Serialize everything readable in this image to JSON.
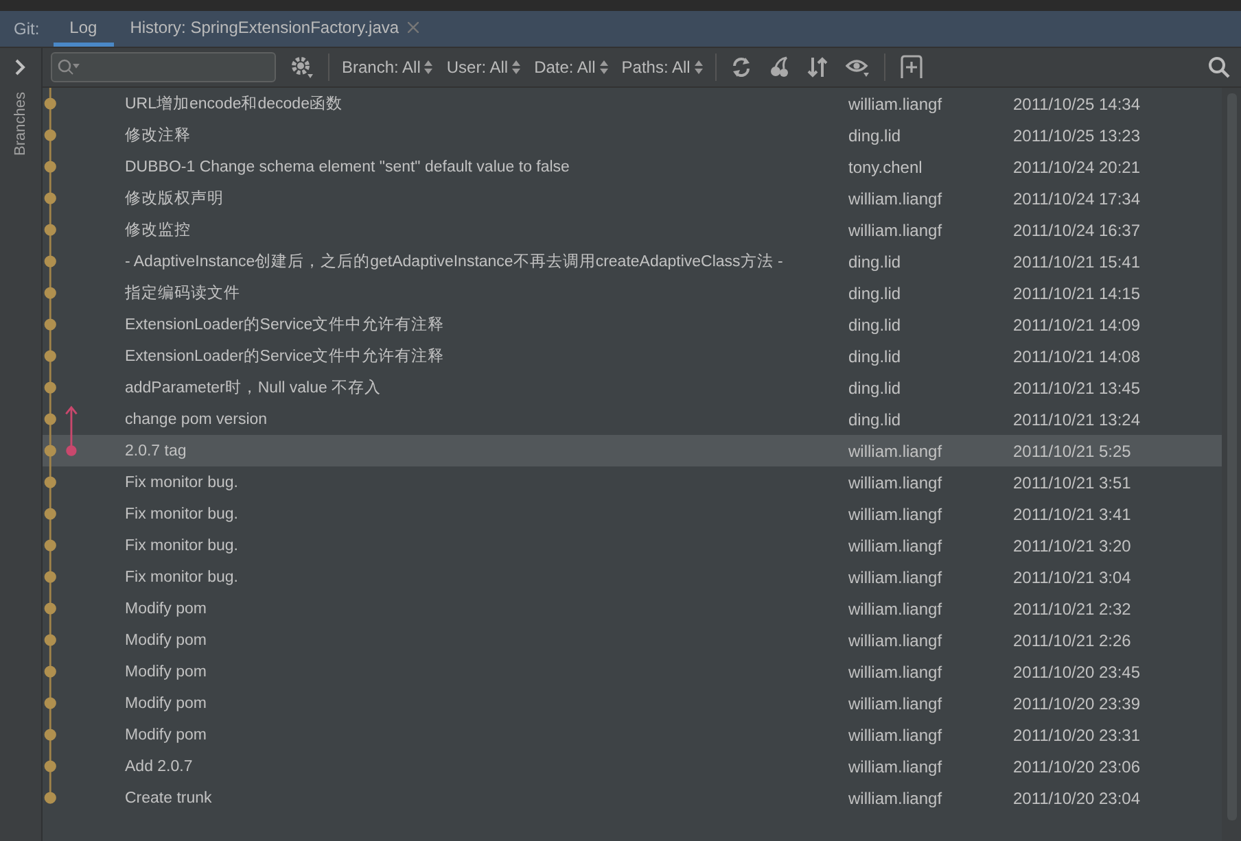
{
  "tabs": {
    "prefix": "Git:",
    "items": [
      {
        "label": "Log",
        "selected": true,
        "closable": false
      },
      {
        "label": "History: SpringExtensionFactory.java",
        "selected": false,
        "closable": true
      }
    ]
  },
  "sidebar": {
    "label": "Branches"
  },
  "toolbar": {
    "filters": [
      "Branch: All",
      "User: All",
      "Date: All",
      "Paths: All"
    ]
  },
  "log": {
    "rows": [
      {
        "message": "URL增加encode和decode函数",
        "author": "william.liangf",
        "date": "2011/10/25 14:34",
        "selected": false
      },
      {
        "message": "修改注释",
        "author": "ding.lid",
        "date": "2011/10/25 13:23",
        "selected": false
      },
      {
        "message": "DUBBO-1 Change schema element \"sent\" default value to false",
        "author": "tony.chenl",
        "date": "2011/10/24 20:21",
        "selected": false
      },
      {
        "message": "修改版权声明",
        "author": "william.liangf",
        "date": "2011/10/24 17:34",
        "selected": false
      },
      {
        "message": "修改监控",
        "author": "william.liangf",
        "date": "2011/10/24 16:37",
        "selected": false
      },
      {
        "message": "- AdaptiveInstance创建后，之后的getAdaptiveInstance不再去调用createAdaptiveClass方法 -",
        "author": "ding.lid",
        "date": "2011/10/21 15:41",
        "selected": false
      },
      {
        "message": "指定编码读文件",
        "author": "ding.lid",
        "date": "2011/10/21 14:15",
        "selected": false
      },
      {
        "message": "ExtensionLoader的Service文件中允许有注释",
        "author": "ding.lid",
        "date": "2011/10/21 14:09",
        "selected": false
      },
      {
        "message": "ExtensionLoader的Service文件中允许有注释",
        "author": "ding.lid",
        "date": "2011/10/21 14:08",
        "selected": false
      },
      {
        "message": "addParameter时，Null value 不存入",
        "author": "ding.lid",
        "date": "2011/10/21 13:45",
        "selected": false
      },
      {
        "message": "change pom version",
        "author": "ding.lid",
        "date": "2011/10/21 13:24",
        "selected": false,
        "kind": "arrow"
      },
      {
        "message": "2.0.7 tag",
        "author": "william.liangf",
        "date": "2011/10/21 5:25",
        "selected": true,
        "kind": "tip"
      },
      {
        "message": "Fix monitor bug.",
        "author": "william.liangf",
        "date": "2011/10/21 3:51",
        "selected": false
      },
      {
        "message": "Fix monitor bug.",
        "author": "william.liangf",
        "date": "2011/10/21 3:41",
        "selected": false
      },
      {
        "message": "Fix monitor bug.",
        "author": "william.liangf",
        "date": "2011/10/21 3:20",
        "selected": false
      },
      {
        "message": "Fix monitor bug.",
        "author": "william.liangf",
        "date": "2011/10/21 3:04",
        "selected": false
      },
      {
        "message": "Modify pom",
        "author": "william.liangf",
        "date": "2011/10/21 2:32",
        "selected": false
      },
      {
        "message": "Modify pom",
        "author": "william.liangf",
        "date": "2011/10/21 2:26",
        "selected": false
      },
      {
        "message": "Modify pom",
        "author": "william.liangf",
        "date": "2011/10/20 23:45",
        "selected": false
      },
      {
        "message": "Modify pom",
        "author": "william.liangf",
        "date": "2011/10/20 23:39",
        "selected": false
      },
      {
        "message": "Modify pom",
        "author": "william.liangf",
        "date": "2011/10/20 23:31",
        "selected": false
      },
      {
        "message": "Add 2.0.7",
        "author": "william.liangf",
        "date": "2011/10/20 23:06",
        "selected": false
      },
      {
        "message": "Create trunk",
        "author": "william.liangf",
        "date": "2011/10/20 23:04",
        "selected": false
      }
    ]
  }
}
